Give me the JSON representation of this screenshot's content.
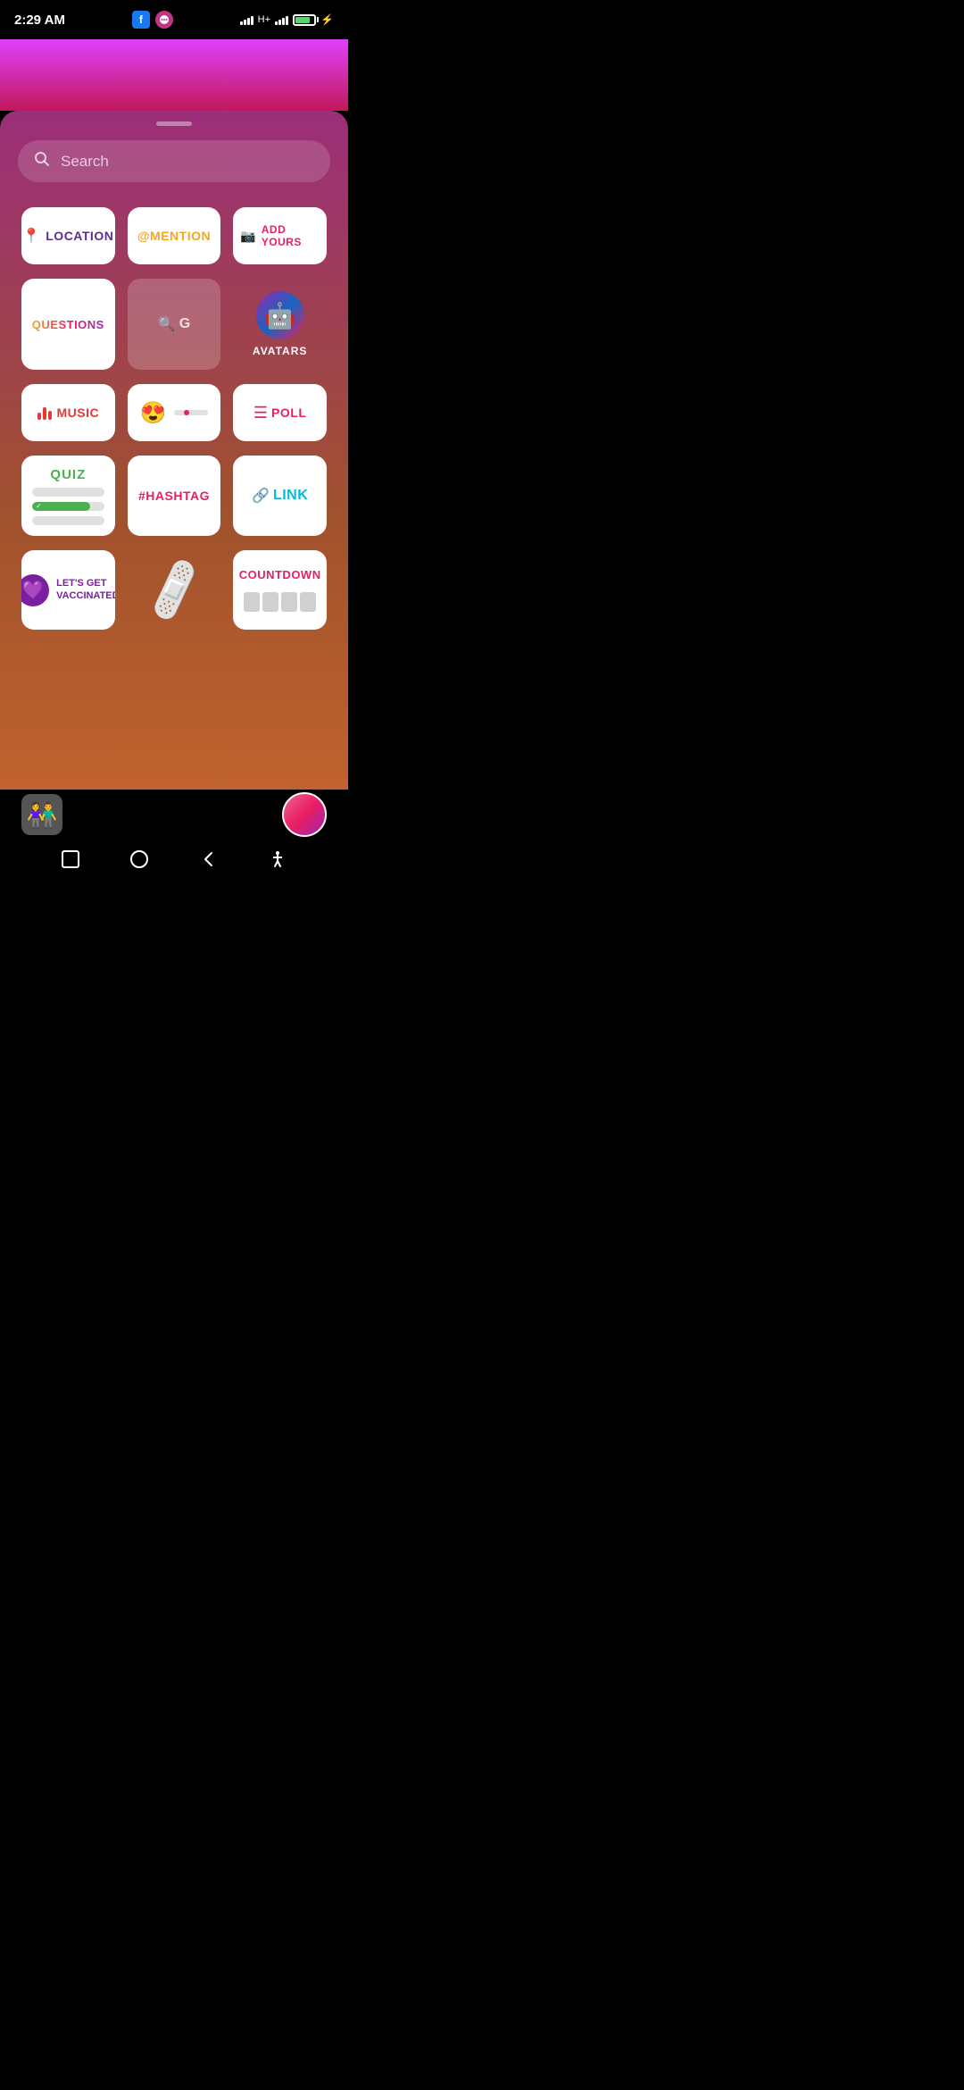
{
  "statusBar": {
    "time": "2:29 AM",
    "battery": "84",
    "fbLabel": "f"
  },
  "search": {
    "placeholder": "Search"
  },
  "stickers": [
    {
      "id": "location",
      "label": "LOCATION",
      "icon": "📍",
      "iconName": "pin-icon"
    },
    {
      "id": "mention",
      "label": "@MENTION",
      "icon": "@",
      "iconName": "at-icon"
    },
    {
      "id": "add-yours",
      "label": "ADD YOURS",
      "icon": "📷",
      "iconName": "camera-icon"
    },
    {
      "id": "questions",
      "label": "QUESTIONS",
      "icon": "",
      "iconName": "questions-icon"
    },
    {
      "id": "gif",
      "label": "G",
      "icon": "🔍",
      "iconName": "search-icon"
    },
    {
      "id": "avatars",
      "label": "AVATARS",
      "icon": "🤖",
      "iconName": "avatar-icon"
    },
    {
      "id": "music",
      "label": "MUSIC",
      "icon": "🎵",
      "iconName": "music-icon"
    },
    {
      "id": "emoji-slider",
      "label": "",
      "icon": "😍",
      "iconName": "emoji-slider-icon"
    },
    {
      "id": "poll",
      "label": "POLL",
      "icon": "☰",
      "iconName": "poll-icon"
    },
    {
      "id": "quiz",
      "label": "QUIZ",
      "icon": "",
      "iconName": "quiz-icon"
    },
    {
      "id": "hashtag",
      "label": "#HASHTAG",
      "icon": "#",
      "iconName": "hashtag-icon"
    },
    {
      "id": "link",
      "label": "LINK",
      "icon": "🔗",
      "iconName": "link-icon"
    },
    {
      "id": "vaccine",
      "label": "LET'S GET VACCINATED",
      "icon": "💜",
      "iconName": "vaccine-icon"
    },
    {
      "id": "bandaid",
      "label": "",
      "icon": "🩹",
      "iconName": "bandaid-icon"
    },
    {
      "id": "countdown",
      "label": "COUNTDOWN",
      "icon": "",
      "iconName": "countdown-icon"
    }
  ],
  "bottomBar": {
    "thumbIcon": "🧑‍🤝‍🧑"
  },
  "navBar": {
    "squareIcon": "⬜",
    "circleIcon": "⬤",
    "backIcon": "◀",
    "accessIcon": "♿"
  }
}
